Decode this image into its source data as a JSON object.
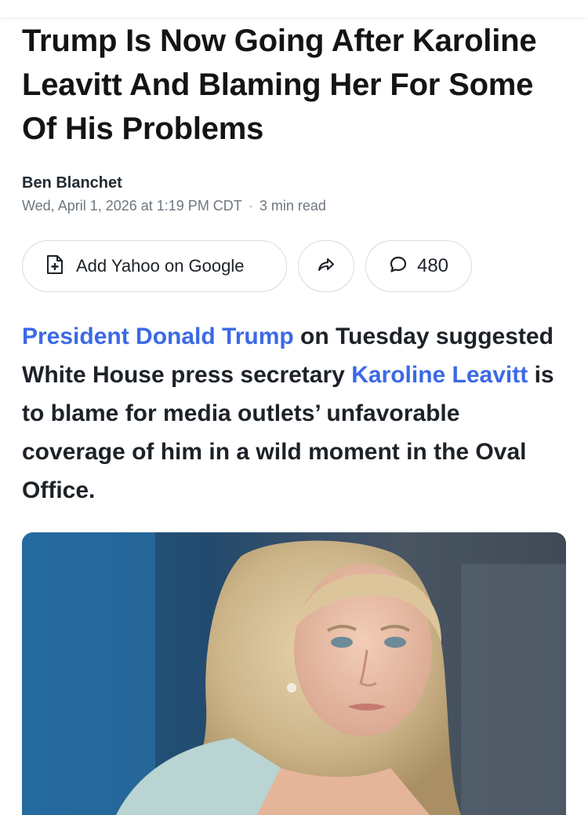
{
  "article": {
    "headline": "Trump Is Now Going After Karoline Leavitt And Blaming Her For Some Of His Problems",
    "author": "Ben Blanchet",
    "date": "Wed, April 1, 2026 at 1:19 PM CDT",
    "meta_separator": "·",
    "read_time": "3 min read",
    "lede": {
      "link1": "President Donald Trump",
      "text1": " on Tuesday suggested White House press secretary ",
      "link2": "Karoline Leavitt",
      "text2": " is to blame for media outlets’ unfavorable coverage of him in a wild moment in the Oval Office."
    }
  },
  "actions": {
    "add_google_label": "Add Yahoo on Google",
    "add_google_icon": "document-plus-icon",
    "share_icon": "share-arrow-icon",
    "comment_icon": "comment-bubble-icon",
    "comment_count": "480"
  },
  "colors": {
    "link": "#3b69e6",
    "text": "#1d2228",
    "meta": "#6e7780",
    "pill_border": "#d7dbe0"
  }
}
